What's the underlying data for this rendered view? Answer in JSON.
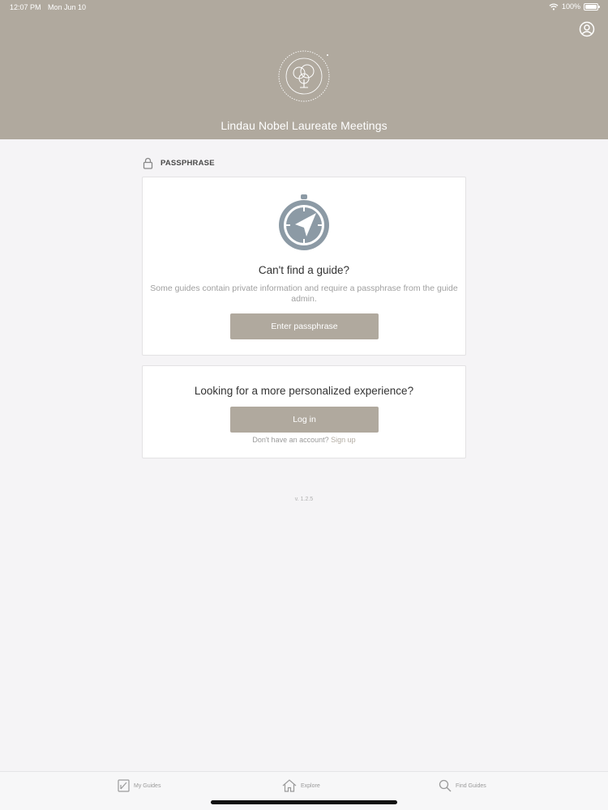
{
  "status_bar": {
    "time": "12:07 PM",
    "date": "Mon Jun 10",
    "battery": "100%",
    "icons": [
      "wifi-icon",
      "battery-icon"
    ]
  },
  "header": {
    "title": "Lindau Nobel Laureate Meetings",
    "profile_icon": "profile-icon",
    "logo_icon": "lindau-logo-seal",
    "background_color": "#b0a99e"
  },
  "section": {
    "label": "PASSPHRASE",
    "icon": "lock-icon"
  },
  "passphrase_card": {
    "icon": "compass-icon",
    "title": "Can't find a guide?",
    "description": "Some guides contain private information and require a passphrase from the guide admin.",
    "button_label": "Enter passphrase"
  },
  "login_card": {
    "title": "Looking for a more personalized experience?",
    "button_label": "Log in",
    "signup_prompt": "Don't have an account?",
    "signup_link": "Sign up"
  },
  "version": "v. 1.2.5",
  "tabbar": {
    "items": [
      {
        "label": "My Guides",
        "icon": "guides-icon"
      },
      {
        "label": "Explore",
        "icon": "home-icon"
      },
      {
        "label": "Find Guides",
        "icon": "search-icon"
      }
    ]
  },
  "colors": {
    "accent": "#b0a99e",
    "background": "#f5f4f6",
    "card": "#ffffff"
  }
}
